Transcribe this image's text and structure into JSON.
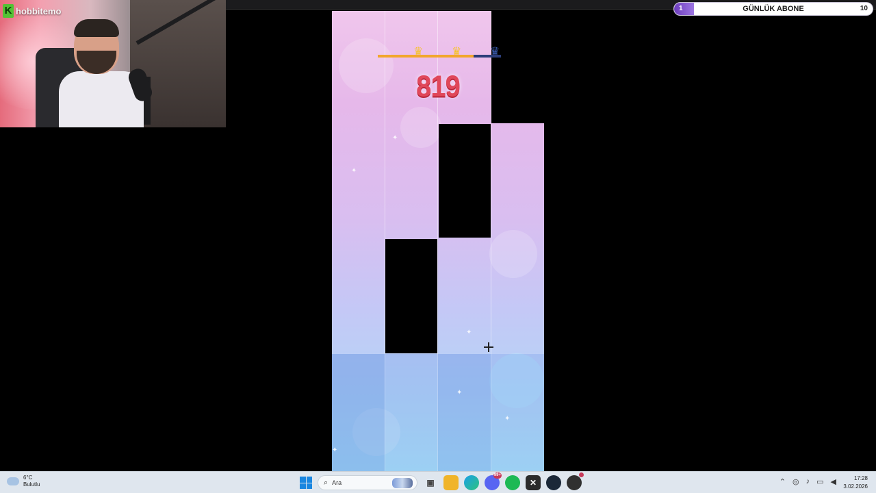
{
  "stream": {
    "channel_name": "hobbitemo",
    "logo_letter": "K",
    "logo_color": "#52c234"
  },
  "goal": {
    "label": "GÜNLÜK ABONE",
    "current": "1",
    "target": "10",
    "progress_fraction": 0.1,
    "fill_color": "#6d3dbd"
  },
  "game": {
    "score": "819",
    "stars_earned": 2,
    "stars_total": 3,
    "level_progress_fraction": 0.78,
    "progress_color": "#f2a62c",
    "track_color": "#2c3e7a",
    "crown_icons": [
      "crown-icon",
      "crown-icon",
      "crown-icon"
    ]
  },
  "taskbar": {
    "weather": {
      "temp": "6°C",
      "condition": "Bulutlu"
    },
    "search_placeholder": "Ara",
    "apps": [
      {
        "name": "file-explorer",
        "icon": "folder-icon"
      },
      {
        "name": "edge",
        "icon": "edge-icon"
      },
      {
        "name": "discord",
        "icon": "discord-icon",
        "badge": "99+"
      },
      {
        "name": "spotify",
        "icon": "spotify-icon"
      },
      {
        "name": "excel",
        "icon": "excel-icon"
      },
      {
        "name": "steam",
        "icon": "steam-icon"
      },
      {
        "name": "obs",
        "icon": "obs-icon"
      }
    ],
    "clock": {
      "time": "17:28",
      "date": "3.02.2026"
    }
  }
}
